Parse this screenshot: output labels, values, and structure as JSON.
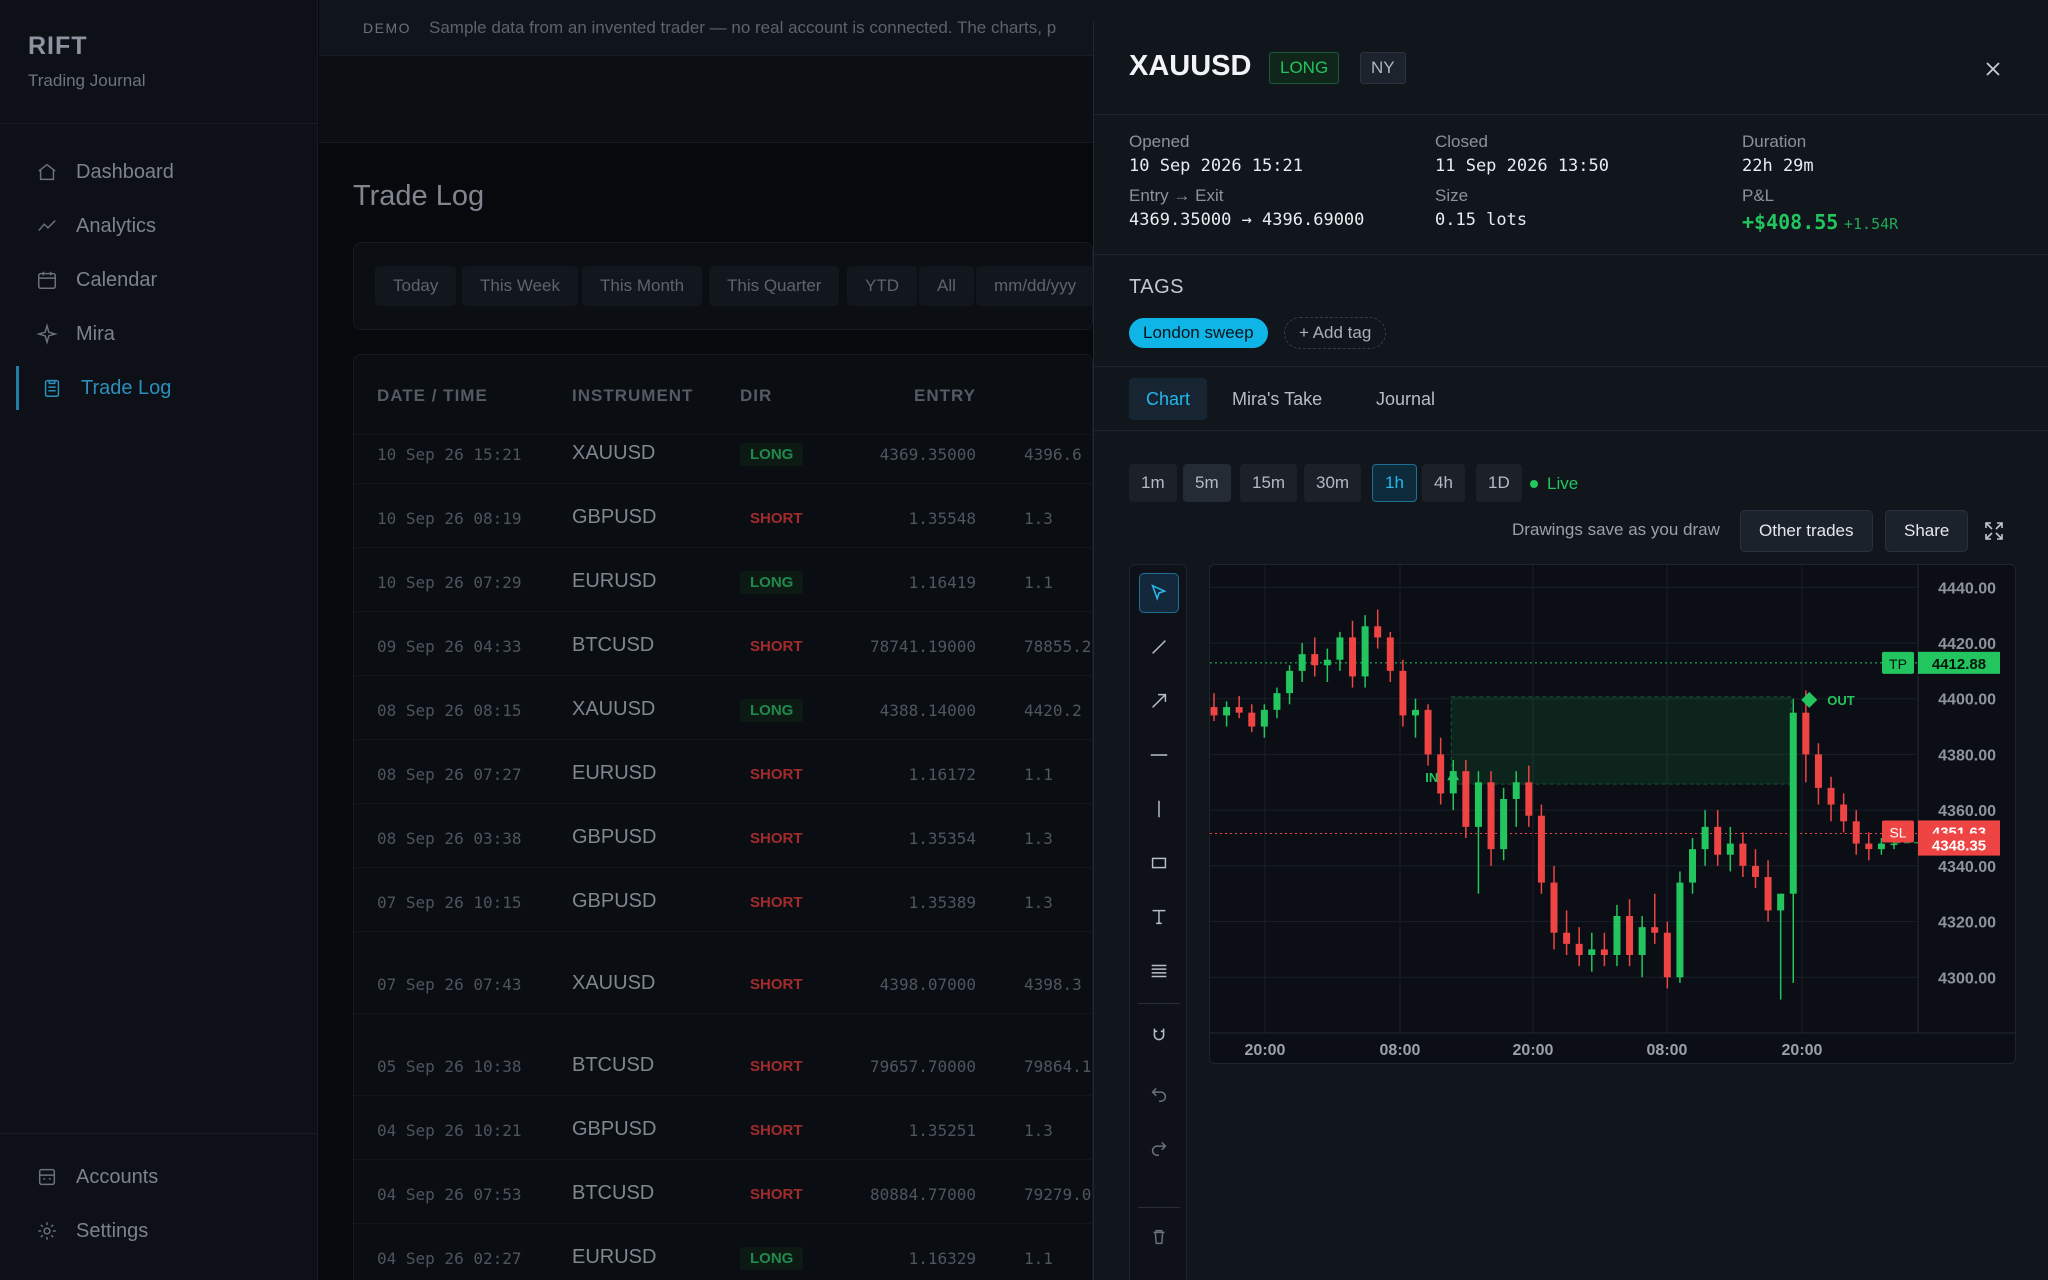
{
  "brand": {
    "name": "RIFT",
    "subtitle": "Trading Journal"
  },
  "nav": {
    "items": [
      {
        "label": "Dashboard",
        "icon": "home-icon"
      },
      {
        "label": "Analytics",
        "icon": "chart-line-icon"
      },
      {
        "label": "Calendar",
        "icon": "calendar-icon"
      },
      {
        "label": "Mira",
        "icon": "sparkle-icon"
      },
      {
        "label": "Trade Log",
        "icon": "clipboard-icon",
        "active": true
      }
    ],
    "bottom": [
      {
        "label": "Accounts",
        "icon": "bank-icon"
      },
      {
        "label": "Settings",
        "icon": "gear-icon"
      }
    ]
  },
  "demo_banner": {
    "tag": "DEMO",
    "text": "Sample data from an invented trader — no real account is connected. The charts, p"
  },
  "page_title": "Trade Log",
  "filters": [
    "Today",
    "This Week",
    "This Month",
    "This Quarter",
    "YTD",
    "All",
    "mm/dd/yyy"
  ],
  "table": {
    "headers": [
      "DATE / TIME",
      "INSTRUMENT",
      "DIR",
      "ENTRY"
    ],
    "rows": [
      {
        "date": "10 Sep 26 15:21",
        "instrument": "XAUUSD",
        "dir": "LONG",
        "entry": "4369.35000",
        "exit": "4396.6"
      },
      {
        "date": "10 Sep 26 08:19",
        "instrument": "GBPUSD",
        "dir": "SHORT",
        "entry": "1.35548",
        "exit": "1.3"
      },
      {
        "date": "10 Sep 26 07:29",
        "instrument": "EURUSD",
        "dir": "LONG",
        "entry": "1.16419",
        "exit": "1.1"
      },
      {
        "date": "09 Sep 26 04:33",
        "instrument": "BTCUSD",
        "dir": "SHORT",
        "entry": "78741.19000",
        "exit": "78855.2"
      },
      {
        "date": "08 Sep 26 08:15",
        "instrument": "XAUUSD",
        "dir": "LONG",
        "entry": "4388.14000",
        "exit": "4420.2"
      },
      {
        "date": "08 Sep 26 07:27",
        "instrument": "EURUSD",
        "dir": "SHORT",
        "entry": "1.16172",
        "exit": "1.1"
      },
      {
        "date": "08 Sep 26 03:38",
        "instrument": "GBPUSD",
        "dir": "SHORT",
        "entry": "1.35354",
        "exit": "1.3"
      },
      {
        "date": "07 Sep 26 10:15",
        "instrument": "GBPUSD",
        "dir": "SHORT",
        "entry": "1.35389",
        "exit": "1.3"
      },
      {
        "date": "07 Sep 26 07:43",
        "instrument": "XAUUSD",
        "dir": "SHORT",
        "entry": "4398.07000",
        "exit": "4398.3"
      },
      {
        "date": "05 Sep 26 10:38",
        "instrument": "BTCUSD",
        "dir": "SHORT",
        "entry": "79657.70000",
        "exit": "79864.1"
      },
      {
        "date": "04 Sep 26 10:21",
        "instrument": "GBPUSD",
        "dir": "SHORT",
        "entry": "1.35251",
        "exit": "1.3"
      },
      {
        "date": "04 Sep 26 07:53",
        "instrument": "BTCUSD",
        "dir": "SHORT",
        "entry": "80884.77000",
        "exit": "79279.0"
      },
      {
        "date": "04 Sep 26 02:27",
        "instrument": "EURUSD",
        "dir": "LONG",
        "entry": "1.16329",
        "exit": "1.1"
      }
    ]
  },
  "drawer": {
    "symbol": "XAUUSD",
    "direction_badge": "LONG",
    "session_badge": "NY",
    "opened_label": "Opened",
    "opened_value": "10 Sep 2026 15:21",
    "closed_label": "Closed",
    "closed_value": "11 Sep 2026 13:50",
    "duration_label": "Duration",
    "duration_value": "22h 29m",
    "entry_exit_label": "Entry → Exit",
    "entry_exit_value": "4369.35000 → 4396.69000",
    "size_label": "Size",
    "size_value": "0.15 lots",
    "pnl_label": "P&L",
    "pnl_value": "+$408.55",
    "pnl_r": "+1.54R",
    "tags_heading": "TAGS",
    "tags": [
      "London sweep"
    ],
    "add_tag_label": "+ Add tag",
    "tabs": [
      "Chart",
      "Mira's Take",
      "Journal"
    ],
    "active_tab": "Chart",
    "timeframes": [
      "1m",
      "5m",
      "15m",
      "30m",
      "1h",
      "4h",
      "1D"
    ],
    "active_timeframe": "1h",
    "live_label": "Live",
    "drawings_note": "Drawings save as you draw",
    "other_trades_label": "Other trades",
    "share_label": "Share",
    "tools": [
      "cursor-icon",
      "trendline-icon",
      "arrow-icon",
      "horizontal-line-icon",
      "vertical-line-icon",
      "rectangle-icon",
      "text-icon",
      "fib-icon",
      "magnet-icon",
      "undo-icon",
      "redo-icon",
      "trash-icon",
      "close-icon"
    ]
  },
  "colors": {
    "up": "#22c55e",
    "down": "#ef4444",
    "accent": "#22b8ee",
    "tp": "#22c55e",
    "sl": "#ef4444"
  },
  "chart_data": {
    "type": "candlestick",
    "symbol": "XAUUSD",
    "timeframe": "1h",
    "x_tick_labels": [
      "20:00",
      "08:00",
      "20:00",
      "08:00",
      "20:00"
    ],
    "y_ticks": [
      4300,
      4320,
      4340,
      4360,
      4380,
      4400,
      4420,
      4440
    ],
    "y_tick_labels": [
      "4300.00",
      "4320.00",
      "4340.00",
      "4360.00",
      "4380.00",
      "4400.00",
      "4420.00",
      "4440.00"
    ],
    "ylim": [
      4280,
      4448
    ],
    "candles": [
      [
        4397,
        4402,
        4392,
        4394
      ],
      [
        4394,
        4399,
        4390,
        4397
      ],
      [
        4397,
        4401,
        4393,
        4395
      ],
      [
        4395,
        4398,
        4388,
        4390
      ],
      [
        4390,
        4398,
        4386,
        4396
      ],
      [
        4396,
        4404,
        4393,
        4402
      ],
      [
        4402,
        4412,
        4398,
        4410
      ],
      [
        4410,
        4420,
        4406,
        4416
      ],
      [
        4416,
        4422,
        4408,
        4412
      ],
      [
        4412,
        4418,
        4406,
        4414
      ],
      [
        4414,
        4424,
        4410,
        4422
      ],
      [
        4422,
        4428,
        4404,
        4408
      ],
      [
        4408,
        4430,
        4404,
        4426
      ],
      [
        4426,
        4432,
        4418,
        4422
      ],
      [
        4422,
        4424,
        4406,
        4410
      ],
      [
        4410,
        4414,
        4390,
        4394
      ],
      [
        4394,
        4400,
        4386,
        4396
      ],
      [
        4396,
        4398,
        4376,
        4380
      ],
      [
        4380,
        4386,
        4362,
        4366
      ],
      [
        4366,
        4378,
        4360,
        4374
      ],
      [
        4374,
        4378,
        4350,
        4354
      ],
      [
        4354,
        4374,
        4330,
        4370
      ],
      [
        4370,
        4374,
        4340,
        4346
      ],
      [
        4346,
        4368,
        4342,
        4364
      ],
      [
        4364,
        4374,
        4354,
        4370
      ],
      [
        4370,
        4376,
        4354,
        4358
      ],
      [
        4358,
        4362,
        4330,
        4334
      ],
      [
        4334,
        4340,
        4310,
        4316
      ],
      [
        4316,
        4324,
        4308,
        4312
      ],
      [
        4312,
        4318,
        4304,
        4308
      ],
      [
        4308,
        4316,
        4302,
        4310
      ],
      [
        4310,
        4316,
        4304,
        4308
      ],
      [
        4308,
        4326,
        4304,
        4322
      ],
      [
        4322,
        4328,
        4304,
        4308
      ],
      [
        4308,
        4322,
        4300,
        4318
      ],
      [
        4318,
        4330,
        4312,
        4316
      ],
      [
        4316,
        4320,
        4296,
        4300
      ],
      [
        4300,
        4338,
        4298,
        4334
      ],
      [
        4334,
        4350,
        4330,
        4346
      ],
      [
        4346,
        4360,
        4340,
        4354
      ],
      [
        4354,
        4360,
        4340,
        4344
      ],
      [
        4344,
        4354,
        4338,
        4348
      ],
      [
        4348,
        4352,
        4336,
        4340
      ],
      [
        4340,
        4346,
        4332,
        4336
      ],
      [
        4336,
        4342,
        4320,
        4324
      ],
      [
        4324,
        4330,
        4292,
        4330
      ],
      [
        4330,
        4400,
        4298,
        4395
      ],
      [
        4395,
        4403,
        4370,
        4380
      ],
      [
        4380,
        4384,
        4362,
        4368
      ],
      [
        4368,
        4372,
        4356,
        4362
      ],
      [
        4362,
        4366,
        4352,
        4356
      ],
      [
        4356,
        4360,
        4344,
        4348
      ],
      [
        4348,
        4352,
        4342,
        4346
      ],
      [
        4346,
        4350,
        4344,
        4348
      ],
      [
        4348,
        4350,
        4346,
        4348
      ]
    ],
    "take_profit": {
      "label": "TP",
      "value": 4412.88
    },
    "stop_loss": {
      "label": "SL",
      "value": 4351.63
    },
    "current_price": 4348.35,
    "entry_marker": {
      "label": "IN",
      "candle": 19,
      "price": 4369.35
    },
    "exit_marker": {
      "label": "OUT",
      "candle": 46,
      "price": 4396.69
    }
  }
}
